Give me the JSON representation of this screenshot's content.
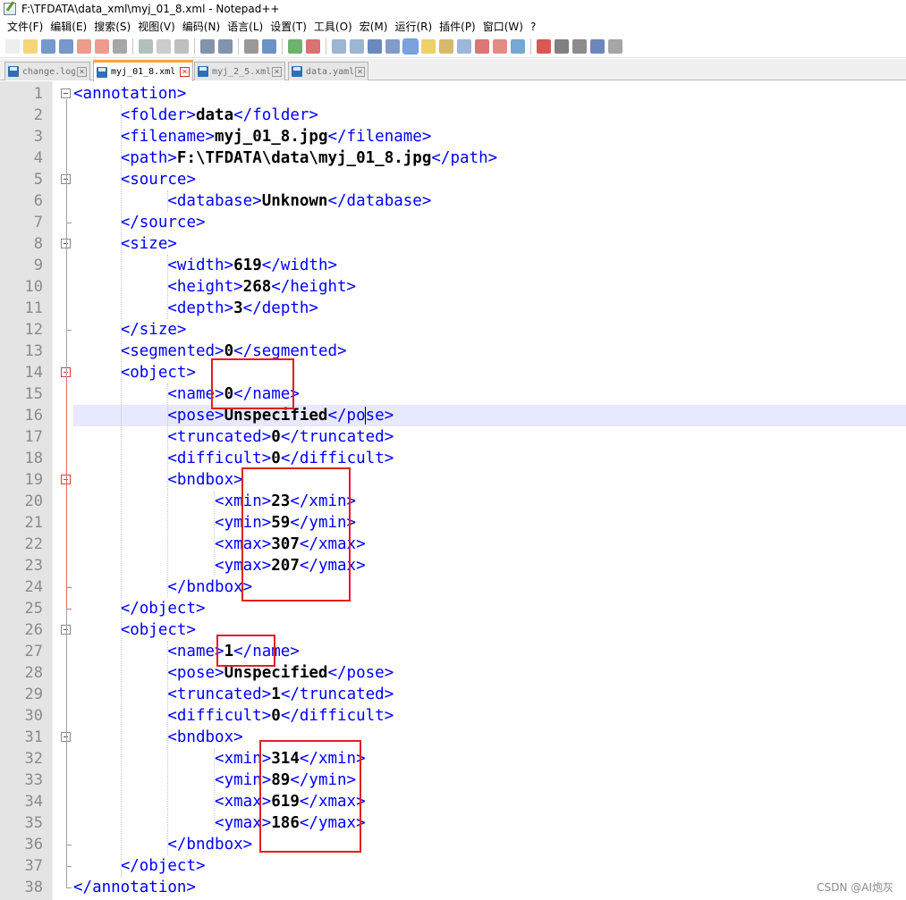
{
  "window": {
    "title": "F:\\TFDATA\\data_xml\\myj_01_8.xml - Notepad++"
  },
  "menu": [
    "文件(F)",
    "编辑(E)",
    "搜索(S)",
    "视图(V)",
    "编码(N)",
    "语言(L)",
    "设置(T)",
    "工具(O)",
    "宏(M)",
    "运行(R)",
    "插件(P)",
    "窗口(W)",
    "?"
  ],
  "toolbar": {
    "icons": [
      "new-file-icon",
      "open-file-icon",
      "save-icon",
      "save-all-icon",
      "close-icon",
      "close-all-icon",
      "print-icon",
      "cut-icon",
      "copy-icon",
      "paste-icon",
      "undo-icon",
      "redo-icon",
      "find-icon",
      "replace-icon",
      "zoom-in-icon",
      "zoom-out-icon",
      "sync-vertical-icon",
      "sync-horizontal-icon",
      "word-wrap-icon",
      "show-all-chars-icon",
      "indent-guide-icon",
      "udl-icon",
      "doc-map-icon",
      "doc-list-icon",
      "function-list-icon",
      "folder-workspace-icon",
      "monitor-icon",
      "record-macro-icon",
      "stop-macro-icon",
      "play-macro-icon",
      "run-macro-multiple-icon",
      "save-macro-icon"
    ]
  },
  "tabs": [
    {
      "label": "change.log",
      "active": false
    },
    {
      "label": "myj_01_8.xml",
      "active": true
    },
    {
      "label": "myj_2_5.xml",
      "active": false
    },
    {
      "label": "data.yaml",
      "active": false
    }
  ],
  "editor": {
    "current_line": 16,
    "lines": [
      {
        "n": "1",
        "tag1": "<annotation>",
        "text": "",
        "tag2": ""
      },
      {
        "n": "2",
        "tag1": "<folder>",
        "text": "data",
        "tag2": "</folder>"
      },
      {
        "n": "3",
        "tag1": "<filename>",
        "text": "myj_01_8.jpg",
        "tag2": "</filename>"
      },
      {
        "n": "4",
        "tag1": "<path>",
        "text": "F:\\TFDATA\\data\\myj_01_8.jpg",
        "tag2": "</path>"
      },
      {
        "n": "5",
        "tag1": "<source>",
        "text": "",
        "tag2": ""
      },
      {
        "n": "6",
        "tag1": "<database>",
        "text": "Unknown",
        "tag2": "</database>"
      },
      {
        "n": "7",
        "tag1": "</source>",
        "text": "",
        "tag2": ""
      },
      {
        "n": "8",
        "tag1": "<size>",
        "text": "",
        "tag2": ""
      },
      {
        "n": "9",
        "tag1": "<width>",
        "text": "619",
        "tag2": "</width>"
      },
      {
        "n": "10",
        "tag1": "<height>",
        "text": "268",
        "tag2": "</height>"
      },
      {
        "n": "11",
        "tag1": "<depth>",
        "text": "3",
        "tag2": "</depth>"
      },
      {
        "n": "12",
        "tag1": "</size>",
        "text": "",
        "tag2": ""
      },
      {
        "n": "13",
        "tag1": "<segmented>",
        "text": "0",
        "tag2": "</segmented>"
      },
      {
        "n": "14",
        "tag1": "<object>",
        "text": "",
        "tag2": ""
      },
      {
        "n": "15",
        "tag1": "<name>",
        "text": "0",
        "tag2": "</name>"
      },
      {
        "n": "16",
        "tag1": "<pose>",
        "text": "Unspecified",
        "tag2": "</pose>"
      },
      {
        "n": "17",
        "tag1": "<truncated>",
        "text": "0",
        "tag2": "</truncated>"
      },
      {
        "n": "18",
        "tag1": "<difficult>",
        "text": "0",
        "tag2": "</difficult>"
      },
      {
        "n": "19",
        "tag1": "<bndbox>",
        "text": "",
        "tag2": ""
      },
      {
        "n": "20",
        "tag1": "<xmin>",
        "text": "23",
        "tag2": "</xmin>"
      },
      {
        "n": "21",
        "tag1": "<ymin>",
        "text": "59",
        "tag2": "</ymin>"
      },
      {
        "n": "22",
        "tag1": "<xmax>",
        "text": "307",
        "tag2": "</xmax>"
      },
      {
        "n": "23",
        "tag1": "<ymax>",
        "text": "207",
        "tag2": "</ymax>"
      },
      {
        "n": "24",
        "tag1": "</bndbox>",
        "text": "",
        "tag2": ""
      },
      {
        "n": "25",
        "tag1": "</object>",
        "text": "",
        "tag2": ""
      },
      {
        "n": "26",
        "tag1": "<object>",
        "text": "",
        "tag2": ""
      },
      {
        "n": "27",
        "tag1": "<name>",
        "text": "1",
        "tag2": "</name>"
      },
      {
        "n": "28",
        "tag1": "<pose>",
        "text": "Unspecified",
        "tag2": "</pose>"
      },
      {
        "n": "29",
        "tag1": "<truncated>",
        "text": "1",
        "tag2": "</truncated>"
      },
      {
        "n": "30",
        "tag1": "<difficult>",
        "text": "0",
        "tag2": "</difficult>"
      },
      {
        "n": "31",
        "tag1": "<bndbox>",
        "text": "",
        "tag2": ""
      },
      {
        "n": "32",
        "tag1": "<xmin>",
        "text": "314",
        "tag2": "</xmin>"
      },
      {
        "n": "33",
        "tag1": "<ymin>",
        "text": "89",
        "tag2": "</ymin>"
      },
      {
        "n": "34",
        "tag1": "<xmax>",
        "text": "619",
        "tag2": "</xmax>"
      },
      {
        "n": "35",
        "tag1": "<ymax>",
        "text": "186",
        "tag2": "</ymax>"
      },
      {
        "n": "36",
        "tag1": "</bndbox>",
        "text": "",
        "tag2": ""
      },
      {
        "n": "37",
        "tag1": "</object>",
        "text": "",
        "tag2": ""
      },
      {
        "n": "38",
        "tag1": "</annotation>",
        "text": "",
        "tag2": ""
      }
    ]
  },
  "colors": {
    "tag": "#0000ff",
    "text": "#000000",
    "highlight_box": "#e02020",
    "current_line": "#e8e8ff",
    "gutter": "#e4e4e4"
  },
  "watermark": "CSDN @AI炮灰"
}
